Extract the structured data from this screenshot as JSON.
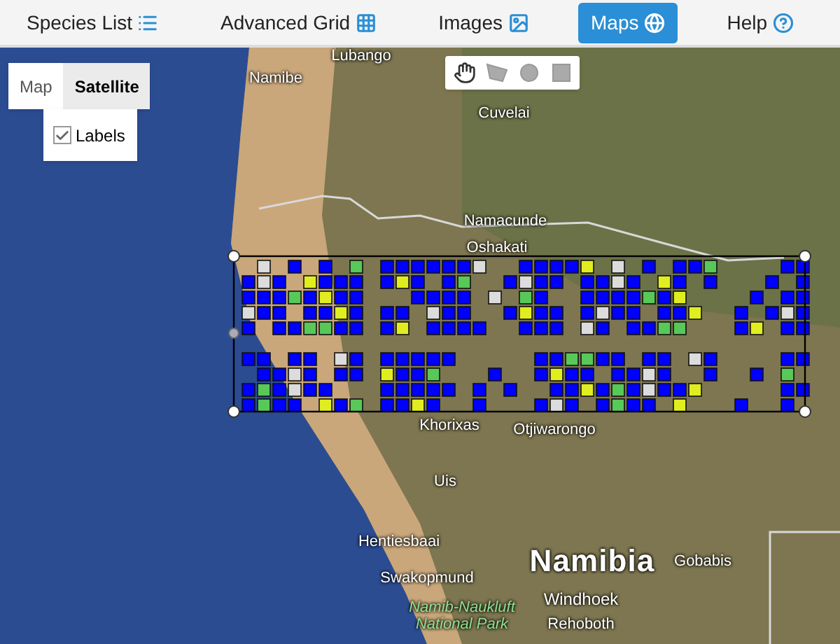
{
  "nav": [
    {
      "label": "Species List",
      "kind": "list",
      "selected": false
    },
    {
      "label": "Advanced Grid",
      "kind": "grid",
      "selected": false
    },
    {
      "label": "Images",
      "kind": "image",
      "selected": false
    },
    {
      "label": "Maps",
      "kind": "globe",
      "selected": true
    },
    {
      "label": "Help",
      "kind": "help",
      "selected": false
    }
  ],
  "map_type": [
    {
      "label": "Map",
      "selected": false
    },
    {
      "label": "Satellite",
      "selected": true
    }
  ],
  "labels_option": {
    "label": "Labels",
    "checked": true
  },
  "draw_tools": [
    {
      "kind": "hand",
      "selected": false
    },
    {
      "kind": "polygon",
      "selected": false
    },
    {
      "kind": "circle",
      "selected": false
    },
    {
      "kind": "rectangle",
      "selected": false
    }
  ],
  "place_labels": [
    {
      "text": "Lubango",
      "kind": "town"
    },
    {
      "text": "Namibe",
      "kind": "town"
    },
    {
      "text": "Cuvelai",
      "kind": "town"
    },
    {
      "text": "Namacunde",
      "kind": "town"
    },
    {
      "text": "Oshakati",
      "kind": "town"
    },
    {
      "text": "Khorixas",
      "kind": "town"
    },
    {
      "text": "Otjiwarongo",
      "kind": "town"
    },
    {
      "text": "Uis",
      "kind": "town"
    },
    {
      "text": "Hentiesbaai",
      "kind": "town"
    },
    {
      "text": "Swakopmund",
      "kind": "town"
    },
    {
      "text": "Namibia",
      "kind": "country"
    },
    {
      "text": "Gobabis",
      "kind": "town"
    },
    {
      "text": "Windhoek",
      "kind": "capital"
    },
    {
      "text": "Rehoboth",
      "kind": "town"
    },
    {
      "text": "Namib-Naukluft National Park",
      "kind": "park"
    }
  ]
}
